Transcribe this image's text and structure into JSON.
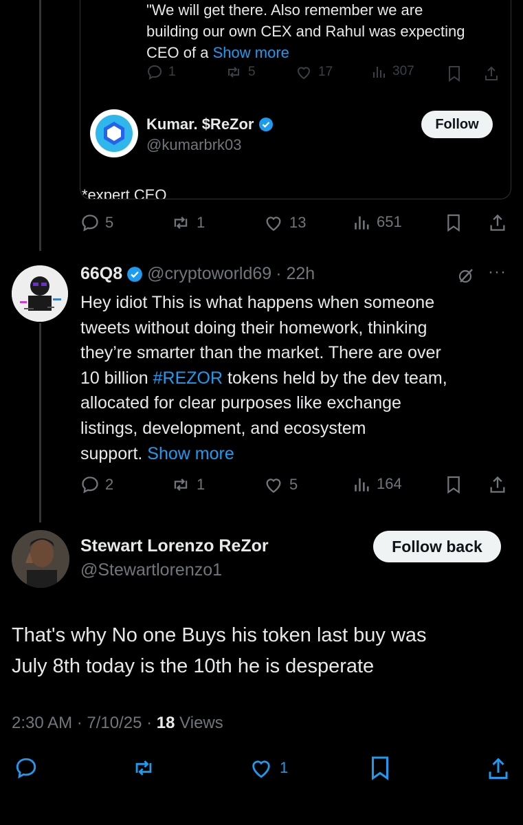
{
  "quoted": {
    "text_line1": "\"We will get there. Also remember we are",
    "text_line2": "building our own CEX and Rahul was expecting",
    "text_line3": "CEO of a",
    "show_more": "Show more",
    "replies": "1",
    "reposts": "5",
    "likes": "17",
    "views": "307",
    "author_name": "Kumar. $ReZor",
    "author_handle": "@kumarbrk03",
    "follow_label": "Follow",
    "reply_text": "*expert CEO",
    "stats": {
      "replies": "5",
      "reposts": "1",
      "likes": "13",
      "views": "651"
    }
  },
  "reply_66q8": {
    "name": "66Q8",
    "handle": "@cryptoworld69",
    "time": "· 22h",
    "more": "···",
    "text_1": "Hey idiot This is what happens when someone",
    "text_2": "tweets without doing their homework, thinking",
    "text_3": "they’re smarter than the market. There are over",
    "text_4a": "10 billion ",
    "hashtag": "#REZOR",
    "text_4b": " tokens held by the dev team,",
    "text_5": "allocated for clear purposes like exchange",
    "text_6": "listings, development, and ecosystem",
    "text_7": "support.",
    "show_more": "Show more",
    "stats": {
      "replies": "2",
      "reposts": "1",
      "likes": "5",
      "views": "164"
    }
  },
  "main_tweet": {
    "name": "Stewart Lorenzo ReZor",
    "handle": "@Stewartlorenzo1",
    "follow_back_label": "Follow back",
    "text_line1": "That's why No one Buys his token last buy was",
    "text_line2": "July 8th today is the 10th he is desperate",
    "timestamp": "2:30 AM · 7/10/25 · ",
    "views_count": "18",
    "views_label": " Views",
    "likes": "1"
  },
  "colors": {
    "accent": "#1d9bf0",
    "muted": "#71767b",
    "background": "#000000"
  }
}
